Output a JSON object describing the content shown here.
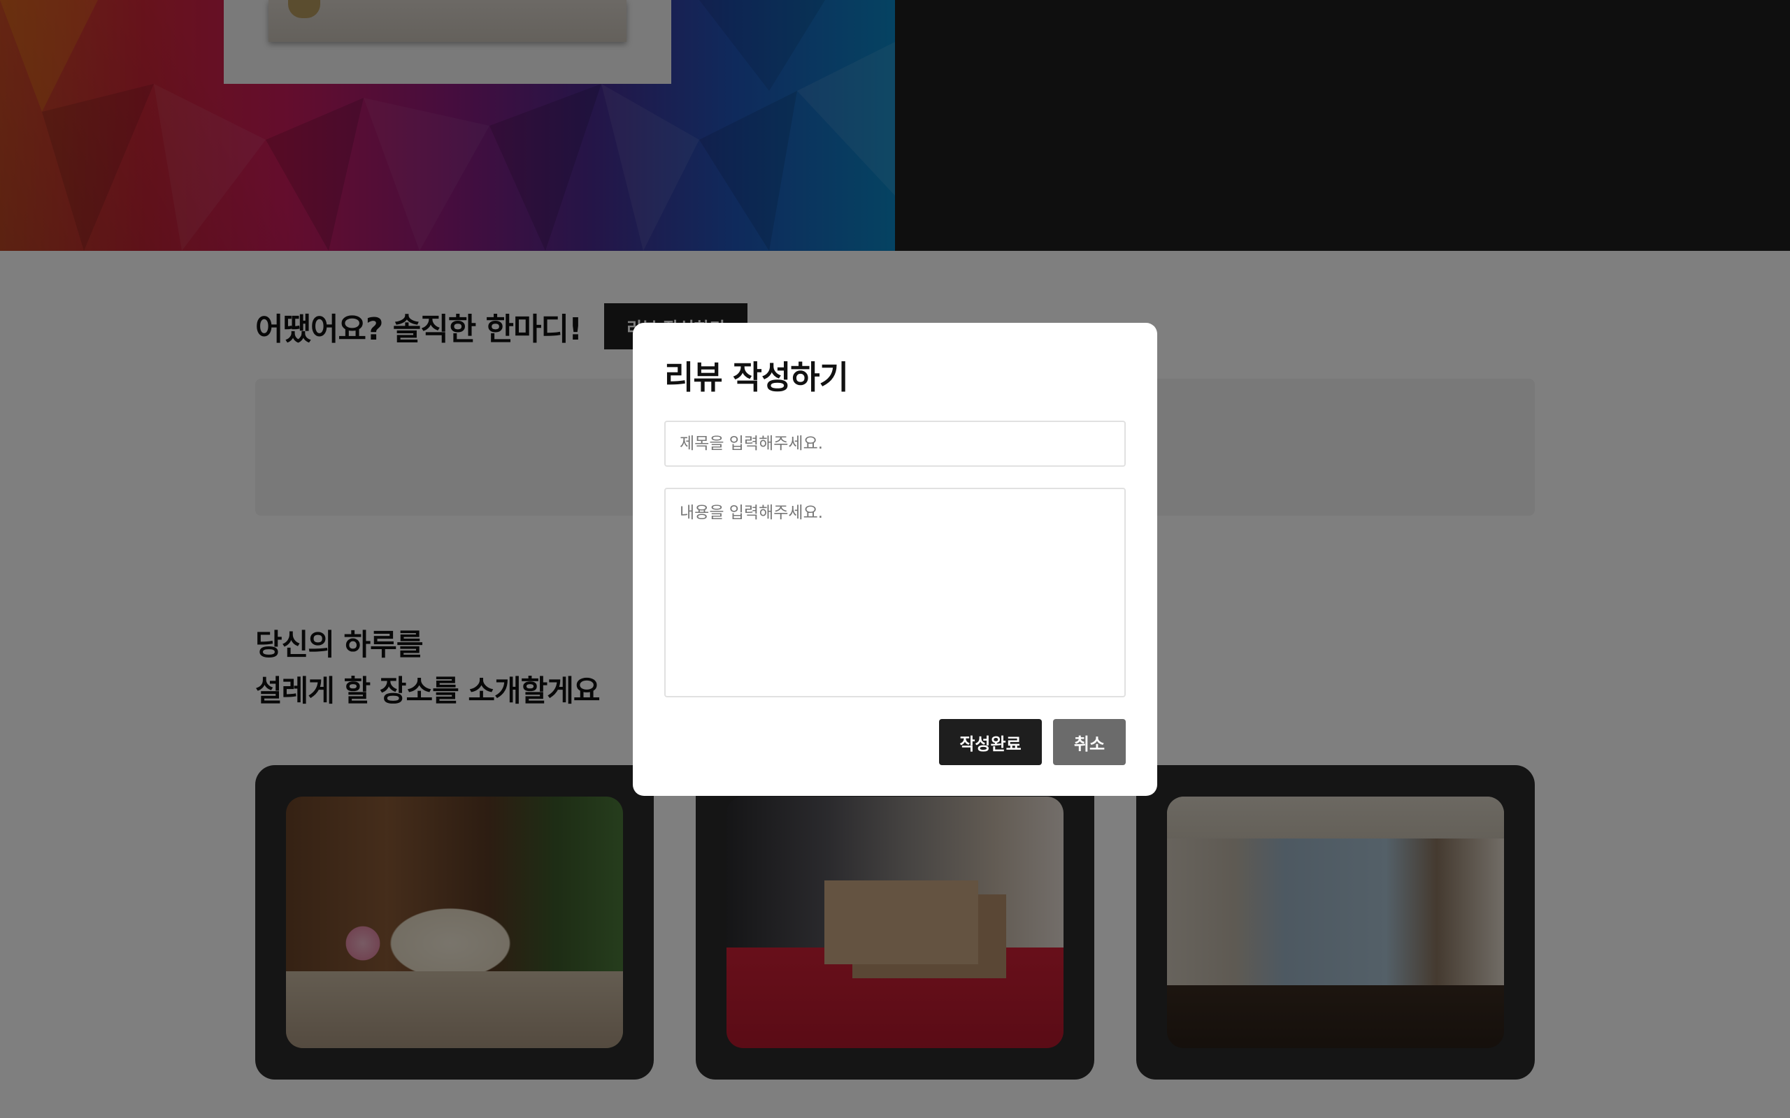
{
  "review": {
    "heading": "어땠어요? 솔직한 한마디!",
    "write_button": "리뷰 작성하기"
  },
  "places": {
    "heading_line1": "당신의 하루를",
    "heading_line2": "설레게 할 장소를 소개할게요"
  },
  "modal": {
    "title": "리뷰 작성하기",
    "title_placeholder": "제목을 입력해주세요.",
    "content_placeholder": "내용을 입력해주세요.",
    "submit_label": "작성완료",
    "cancel_label": "취소"
  }
}
